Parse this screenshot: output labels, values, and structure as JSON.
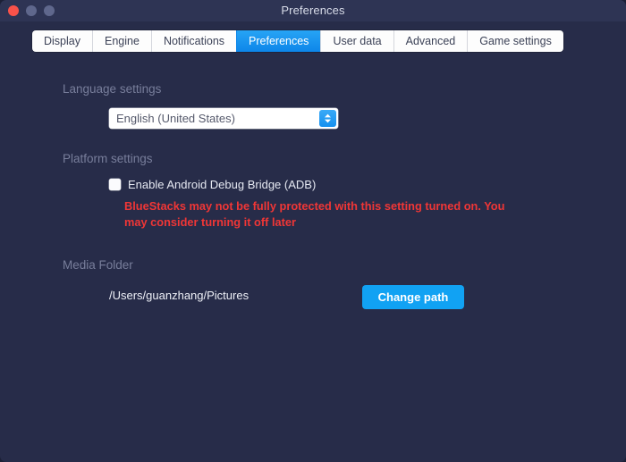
{
  "window": {
    "title": "Preferences",
    "traffic_lights": [
      {
        "name": "close",
        "color": "#f9524a"
      },
      {
        "name": "minimize",
        "color": "#5f678c"
      },
      {
        "name": "zoom",
        "color": "#5f678c"
      }
    ],
    "background": "#272c49",
    "titlebar_background": "#2e3454"
  },
  "tabs": [
    {
      "label": "Display",
      "selected": false
    },
    {
      "label": "Engine",
      "selected": false
    },
    {
      "label": "Notifications",
      "selected": false
    },
    {
      "label": "Preferences",
      "selected": true
    },
    {
      "label": "User data",
      "selected": false
    },
    {
      "label": "Advanced",
      "selected": false
    },
    {
      "label": "Game settings",
      "selected": false
    }
  ],
  "accent_color": "#11a2f3",
  "warning_color": "#f03636",
  "sections": {
    "language": {
      "label": "Language settings",
      "select": {
        "value": "English (United States)",
        "stepper_icon": "chevron-up-down-icon"
      }
    },
    "platform": {
      "label": "Platform settings",
      "checkbox": {
        "label": "Enable Android Debug Bridge (ADB)",
        "checked": false
      },
      "warning": "BlueStacks may not be fully protected with this setting turned on. You may consider turning it off later"
    },
    "media": {
      "label": "Media Folder",
      "path": "/Users/guanzhang/Pictures",
      "button_label": "Change path"
    }
  }
}
